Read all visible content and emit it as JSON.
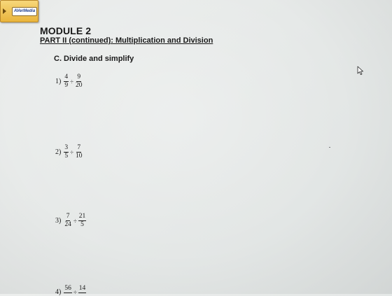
{
  "overlay": {
    "logo_text": "AVerMedia"
  },
  "document": {
    "module_title": "MODULE 2",
    "part_title": "PART II (continued): Multiplication and Division",
    "section_title": "C.  Divide and simplify",
    "operator": "÷",
    "problems": [
      {
        "number": "1)",
        "a_num": "4",
        "a_den": "9",
        "b_num": "9",
        "b_den": "20"
      },
      {
        "number": "2)",
        "a_num": "3",
        "a_den": "5",
        "b_num": "7",
        "b_den": "10"
      },
      {
        "number": "3)",
        "a_num": "7",
        "a_den": "24",
        "b_num": "21",
        "b_den": "5"
      },
      {
        "number": "4)",
        "a_num": "56",
        "a_den": "",
        "b_num": "14",
        "b_den": ""
      }
    ]
  }
}
